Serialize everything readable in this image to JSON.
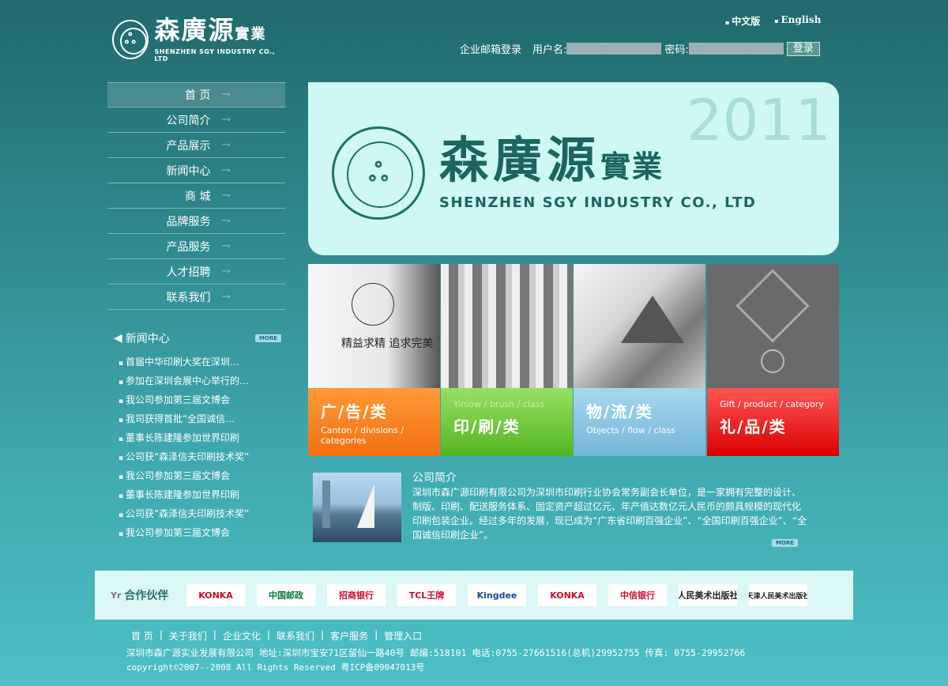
{
  "header": {
    "logo_cn": "森廣源",
    "logo_cn_suffix": "實業",
    "logo_en": "SHENZHEN SGY INDUSTRY CO., LTD",
    "lang_cn": "中文版",
    "lang_en": "English",
    "login_label": "企业邮箱登录",
    "username_label": "用户名:",
    "password_label": "密码:",
    "login_button": "登录"
  },
  "nav": {
    "items": [
      {
        "label": "首 页"
      },
      {
        "label": "公司简介"
      },
      {
        "label": "产品展示"
      },
      {
        "label": "新闻中心"
      },
      {
        "label": "商 城"
      },
      {
        "label": "品牌服务"
      },
      {
        "label": "产品服务"
      },
      {
        "label": "人才招聘"
      },
      {
        "label": "联系我们"
      }
    ],
    "arrow": "····›"
  },
  "news": {
    "title": "新闻中心",
    "more": "MORE",
    "items": [
      "首届中华印刷大奖在深圳…",
      "参加在深圳会展中心举行的…",
      "我公司参加第三届文博会",
      "我司获得首批“全国诚信…",
      "董事长陈建隆参加世界印刷",
      "公司获“森泽信夫印刷技术奖”",
      "我公司参加第三届文博会",
      "董事长陈建隆参加世界印刷",
      "公司获“森泽信夫印刷技术奖”",
      "我公司参加第三届文博会"
    ]
  },
  "banner": {
    "year": "2011",
    "cn": "森廣源",
    "cn_suffix": "實業",
    "en": "SHENZHEN SGY INDUSTRY CO., LTD"
  },
  "categories": [
    {
      "big": "广/告/类",
      "small": "Canton / divisions / categories",
      "art": "精益求精 追求完美"
    },
    {
      "big": "印/刷/类",
      "small": "Yinlow / brush / class"
    },
    {
      "big": "物/流/类",
      "small": "Objects / flow / class"
    },
    {
      "big": "礼/品/类",
      "small": "Gift / product / category"
    }
  ],
  "about": {
    "title": "公司简介",
    "text": "深圳市森广源印刷有限公司为深圳市印刷行业协会常务副会长单位，是一家拥有完整的设计、制版、印刷、配送服务体系、固定资产超过亿元、年产值达数亿元人民币的颇具规模的现代化印刷包装企业。经过多年的发展，现已成为“广东省印刷百强企业”、“全国印刷百强企业”、“全国诚信印刷企业”。",
    "more": "MORE"
  },
  "partners": {
    "title": "合作伙伴",
    "logos": [
      "KONKA",
      "中国邮政",
      "招商银行",
      "TCL王牌",
      "Kingdee",
      "KONKA",
      "中信银行",
      "人民美术出版社",
      "天津人民美术出版社"
    ]
  },
  "footer": {
    "links": [
      "首 页",
      "关于我们",
      "企业文化",
      "联系我们",
      "客户服务",
      "管理入口"
    ],
    "separator": "|",
    "line1": "深圳市森广源实业发展有限公司 地址:深圳市宝安71区留仙一路40号  邮编:518101 电话:0755-27661516(总机)29952755 传真: 0755-29952766",
    "line2": "copyright©2007--2008 All Rights Reserved 粤ICP备09047013号"
  }
}
